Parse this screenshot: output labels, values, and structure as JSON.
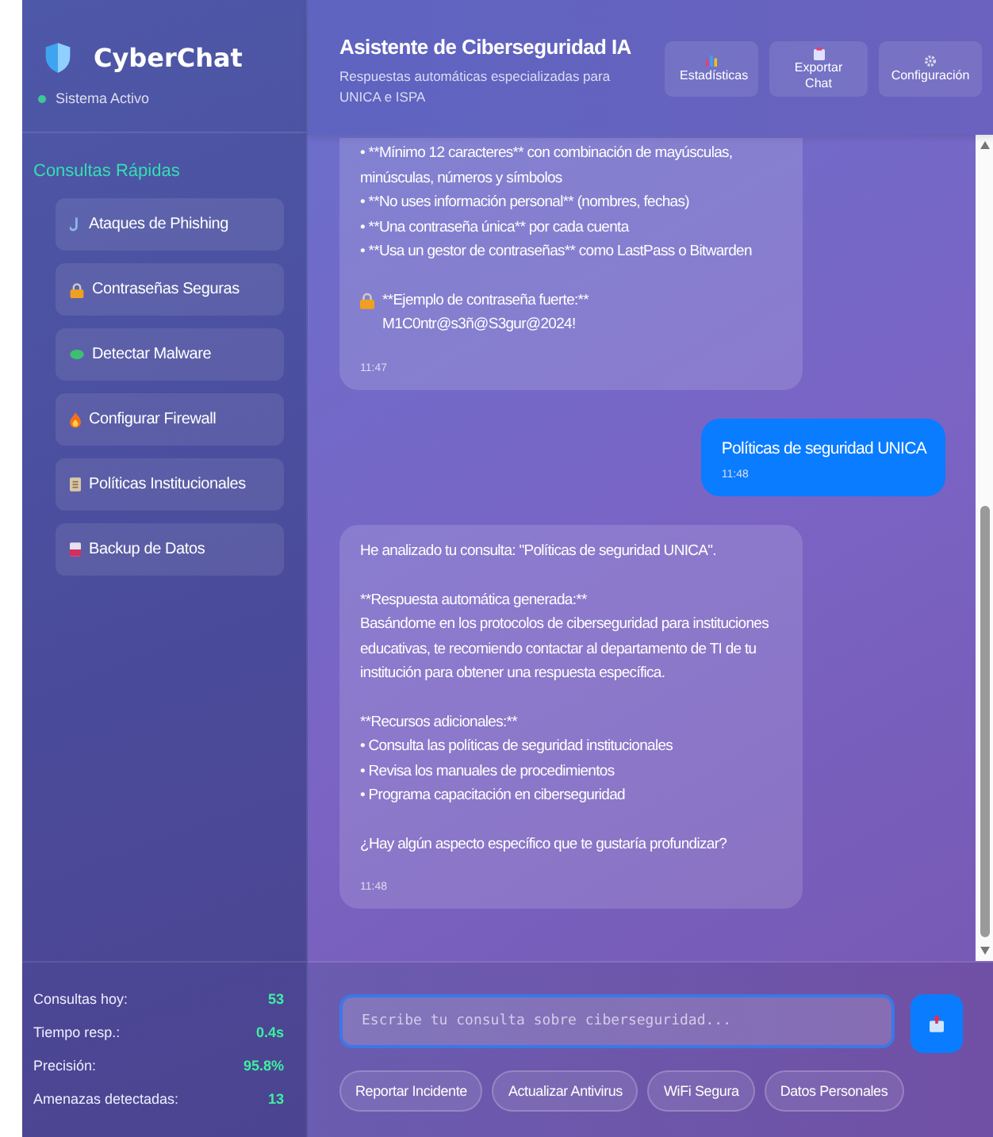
{
  "sidebar": {
    "logo": "CyberChat",
    "status": "Sistema Activo",
    "status_active": true,
    "quick_title": "Consultas Rápidas",
    "quick_items": [
      {
        "kind": "hook",
        "label": "Ataques de Phishing"
      },
      {
        "kind": "lock",
        "label": "Contraseñas Seguras"
      },
      {
        "kind": "bug",
        "label": "Detectar Malware"
      },
      {
        "kind": "flame",
        "label": "Configurar Firewall"
      },
      {
        "kind": "document",
        "label": "Políticas Institucionales"
      },
      {
        "kind": "disk",
        "label": "Backup de Datos"
      }
    ],
    "stats": [
      {
        "label": "Consultas hoy:",
        "value": "53"
      },
      {
        "label": "Tiempo resp.:",
        "value": "0.4s"
      },
      {
        "label": "Precisión:",
        "value": "95.8%"
      },
      {
        "label": "Amenazas detectadas:",
        "value": "13"
      }
    ]
  },
  "header": {
    "title": "Asistente de Ciberseguridad IA",
    "subtitle": "Respuestas automáticas especializadas para UNICA e ISPA",
    "buttons": [
      {
        "kind": "chart",
        "label": "Estadísticas"
      },
      {
        "kind": "clipboard",
        "label": "Exportar Chat"
      },
      {
        "kind": "gear",
        "label": "Configuración"
      }
    ]
  },
  "messages": [
    {
      "kind": "received",
      "paragraphs": [
        {
          "kind": "text",
          "text": "• **Mínimo 12 caracteres** con combinación de mayúsculas, minúsculas, números y símbolos\n• **No uses información personal** (nombres, fechas)\n• **Una contraseña única** por cada cuenta\n• **Usa un gestor de contraseñas** como LastPass o Bitwarden"
        },
        {
          "kind": "lock",
          "text": "**Ejemplo de contraseña fuerte:**\nM1C0ntr@s3ñ@S3gur@2024!"
        }
      ],
      "time": "11:47"
    },
    {
      "kind": "sent",
      "paragraphs": [
        {
          "kind": "text",
          "text": "Políticas de seguridad UNICA"
        }
      ],
      "time": "11:48"
    },
    {
      "kind": "received",
      "paragraphs": [
        {
          "kind": "text",
          "text": "He analizado tu consulta: \"Políticas de seguridad UNICA\"."
        },
        {
          "kind": "text",
          "text": "**Respuesta automática generada:**\nBasándome en los protocolos de ciberseguridad para instituciones educativas, te recomiendo contactar al departamento de TI de tu institución para obtener una respuesta específica."
        },
        {
          "kind": "text",
          "text": "**Recursos adicionales:**\n• Consulta las políticas de seguridad institucionales\n• Revisa los manuales de procedimientos\n• Programa capacitación en ciberseguridad"
        },
        {
          "kind": "text",
          "text": "¿Hay algún aspecto específico que te gustaría profundizar?"
        }
      ],
      "time": "11:48"
    }
  ],
  "composer": {
    "placeholder": "Escribe tu consulta sobre ciberseguridad...",
    "suggestions": [
      "Reportar Incidente",
      "Actualizar Antivirus",
      "WiFi Segura",
      "Datos Personales"
    ]
  }
}
